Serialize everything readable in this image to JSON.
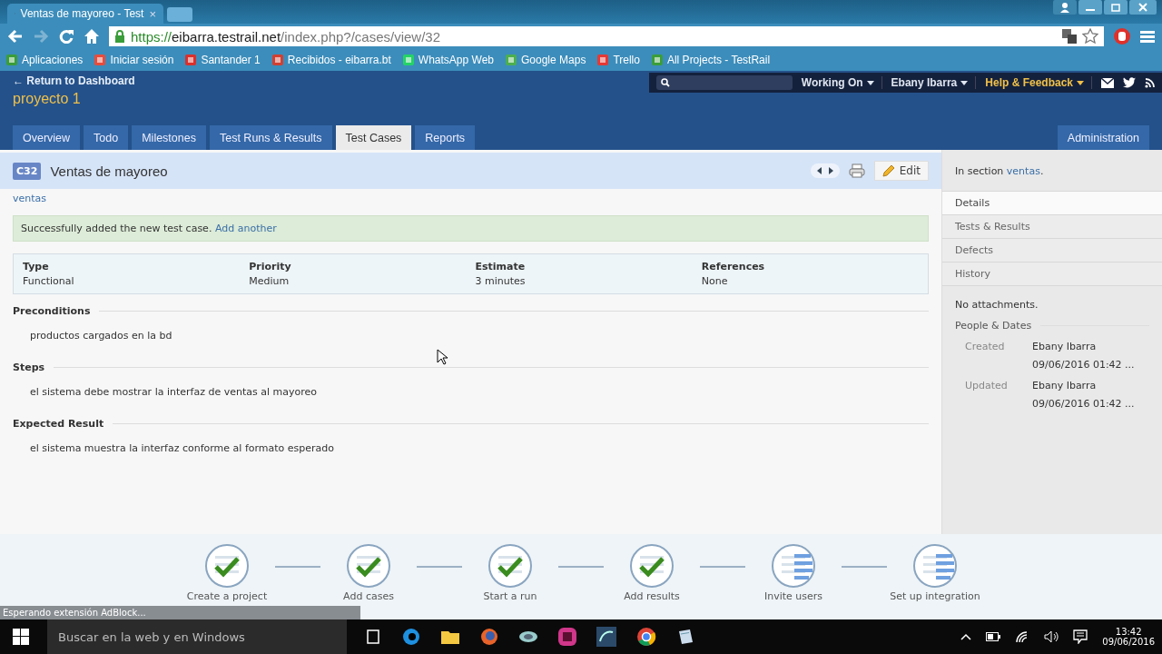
{
  "browser": {
    "tab_title": "Ventas de mayoreo - Test",
    "tab_close": "×",
    "url": {
      "scheme": "https://",
      "host": "eibarra.testrail.net",
      "path": "/index.php?/cases/view/32"
    },
    "bookmarks": [
      {
        "label": "Aplicaciones",
        "kind": "apps"
      },
      {
        "label": "Iniciar sesión",
        "kind": "tiles"
      },
      {
        "label": "Santander 1",
        "kind": "flame"
      },
      {
        "label": "Recibidos - eibarra.bt",
        "kind": "mail"
      },
      {
        "label": "WhatsApp Web",
        "kind": "chat"
      },
      {
        "label": "Google Maps",
        "kind": "map"
      },
      {
        "label": "Trello",
        "kind": "pin"
      },
      {
        "label": "All Projects - TestRail",
        "kind": "apps"
      }
    ]
  },
  "header": {
    "return_link": "← Return to Dashboard",
    "project": "proyecto 1",
    "top_nav": [
      {
        "label": "Working On",
        "highlight": false
      },
      {
        "label": "Ebany Ibarra",
        "highlight": false
      },
      {
        "label": "Help & Feedback",
        "highlight": true
      }
    ],
    "tabs": [
      {
        "label": "Overview",
        "selected": false
      },
      {
        "label": "Todo",
        "selected": false
      },
      {
        "label": "Milestones",
        "selected": false
      },
      {
        "label": "Test Runs & Results",
        "selected": false
      },
      {
        "label": "Test Cases",
        "selected": true
      },
      {
        "label": "Reports",
        "selected": false
      }
    ],
    "admin_tab": "Administration"
  },
  "case": {
    "id": "C32",
    "title": "Ventas de mayoreo",
    "edit": "Edit",
    "section_link": "ventas",
    "message": "Successfully added the new test case.",
    "message_link": "Add another",
    "fields": [
      {
        "label": "Type",
        "value": "Functional"
      },
      {
        "label": "Priority",
        "value": "Medium"
      },
      {
        "label": "Estimate",
        "value": "3 minutes"
      },
      {
        "label": "References",
        "value": "None"
      }
    ],
    "sections": [
      {
        "heading": "Preconditions",
        "text": "productos cargados en la bd"
      },
      {
        "heading": "Steps",
        "text": "el sistema debe mostrar la interfaz de ventas al mayoreo"
      },
      {
        "heading": "Expected Result",
        "text": "el sistema muestra la interfaz conforme al formato esperado"
      }
    ]
  },
  "sidebar": {
    "section_prefix": "In section ",
    "section_link": "ventas",
    "section_suffix": ".",
    "tabs": [
      {
        "label": "Details",
        "selected": true
      },
      {
        "label": "Tests & Results",
        "selected": false
      },
      {
        "label": "Defects",
        "selected": false
      },
      {
        "label": "History",
        "selected": false
      }
    ],
    "attachments": "No attachments.",
    "people_heading": "People & Dates",
    "people": [
      {
        "label": "Created",
        "name": "Ebany Ibarra",
        "date": "09/06/2016 01:42 ..."
      },
      {
        "label": "Updated",
        "name": "Ebany Ibarra",
        "date": "09/06/2016 01:42 ..."
      }
    ]
  },
  "onboarding": [
    {
      "label": "Create a project",
      "done": true
    },
    {
      "label": "Add cases",
      "done": true
    },
    {
      "label": "Start a run",
      "done": true
    },
    {
      "label": "Add results",
      "done": true
    },
    {
      "label": "Invite users",
      "done": false
    },
    {
      "label": "Set up integration",
      "done": false
    }
  ],
  "status_bubble": "Esperando extensión AdBlock...",
  "taskbar": {
    "search_placeholder": "Buscar en la web y en Windows",
    "time": "13:42",
    "date": "09/06/2016"
  }
}
